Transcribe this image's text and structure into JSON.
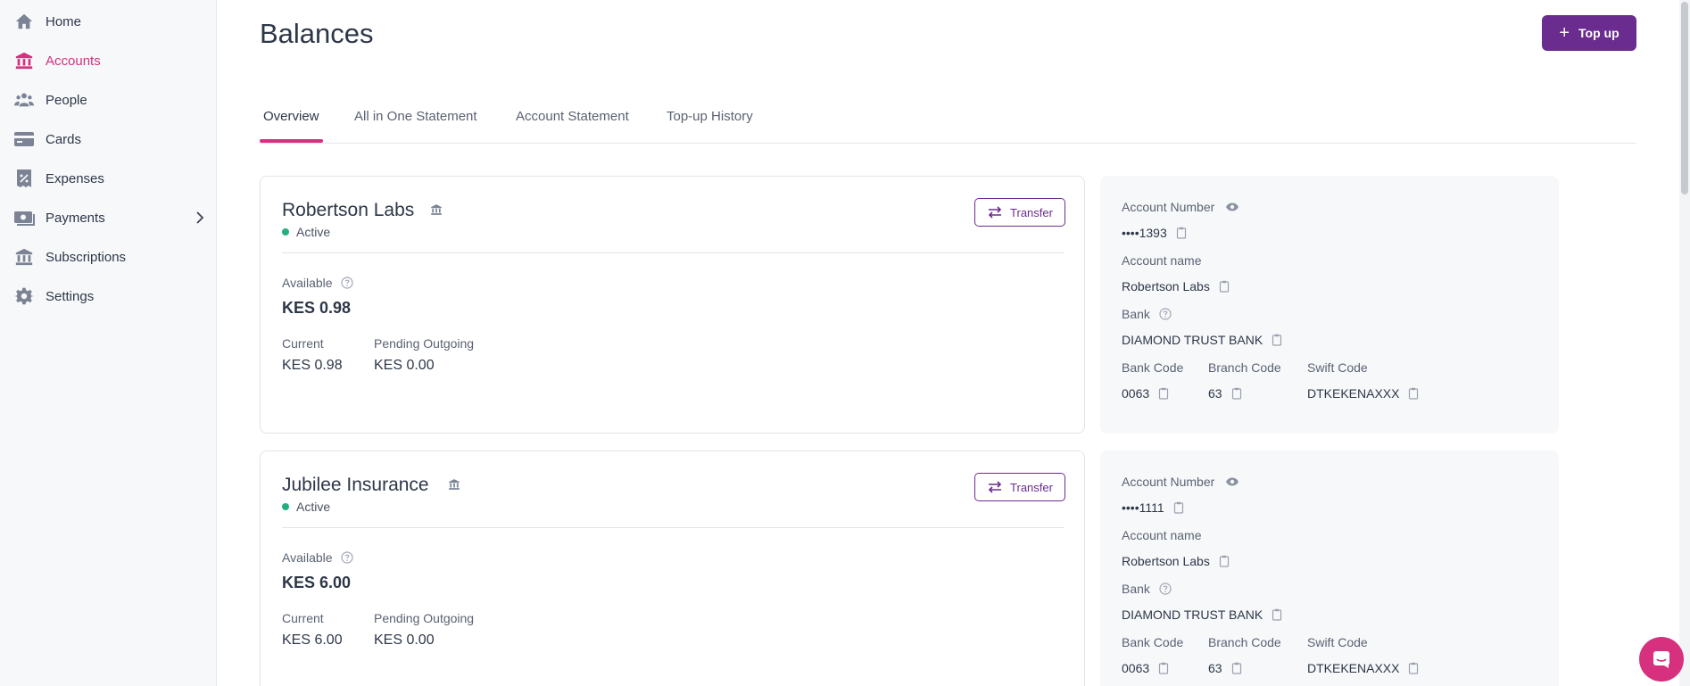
{
  "sidebar": {
    "items": [
      {
        "label": "Home",
        "icon": "home-icon"
      },
      {
        "label": "Accounts",
        "icon": "bank-icon",
        "active": true
      },
      {
        "label": "People",
        "icon": "people-icon"
      },
      {
        "label": "Cards",
        "icon": "card-icon"
      },
      {
        "label": "Expenses",
        "icon": "expenses-icon"
      },
      {
        "label": "Payments",
        "icon": "payments-icon",
        "has_submenu": true
      },
      {
        "label": "Subscriptions",
        "icon": "subscriptions-icon"
      },
      {
        "label": "Settings",
        "icon": "gear-icon"
      }
    ]
  },
  "header": {
    "title": "Balances",
    "topup_label": "Top up"
  },
  "tabs": [
    {
      "label": "Overview",
      "active": true
    },
    {
      "label": "All in One Statement"
    },
    {
      "label": "Account Statement"
    },
    {
      "label": "Top-up History"
    }
  ],
  "accounts": [
    {
      "name": "Robertson Labs",
      "status": "Active",
      "transfer_label": "Transfer",
      "available_label": "Available",
      "available": "KES 0.98",
      "current_label": "Current",
      "current": "KES 0.98",
      "pending_label": "Pending Outgoing",
      "pending": "KES 0.00",
      "details": {
        "account_number_label": "Account Number",
        "account_number": "••••1393",
        "account_name_label": "Account name",
        "account_name": "Robertson Labs",
        "bank_label": "Bank",
        "bank": "DIAMOND TRUST BANK",
        "bank_code_label": "Bank Code",
        "bank_code": "0063",
        "branch_code_label": "Branch Code",
        "branch_code": "63",
        "swift_code_label": "Swift Code",
        "swift_code": "DTKEKENAXXX"
      }
    },
    {
      "name": "Jubilee Insurance",
      "status": "Active",
      "transfer_label": "Transfer",
      "available_label": "Available",
      "available": "KES 6.00",
      "current_label": "Current",
      "current": "KES 6.00",
      "pending_label": "Pending Outgoing",
      "pending": "KES 0.00",
      "details": {
        "account_number_label": "Account Number",
        "account_number": "••••1111",
        "account_name_label": "Account name",
        "account_name": "Robertson Labs",
        "bank_label": "Bank",
        "bank": "DIAMOND TRUST BANK",
        "bank_code_label": "Bank Code",
        "bank_code": "0063",
        "branch_code_label": "Branch Code",
        "branch_code": "63",
        "swift_code_label": "Swift Code",
        "swift_code": "DTKEKENAXXX"
      }
    }
  ],
  "colors": {
    "accent": "#d6307f",
    "brand": "#6a2c8e",
    "active_status": "#22b07d"
  }
}
